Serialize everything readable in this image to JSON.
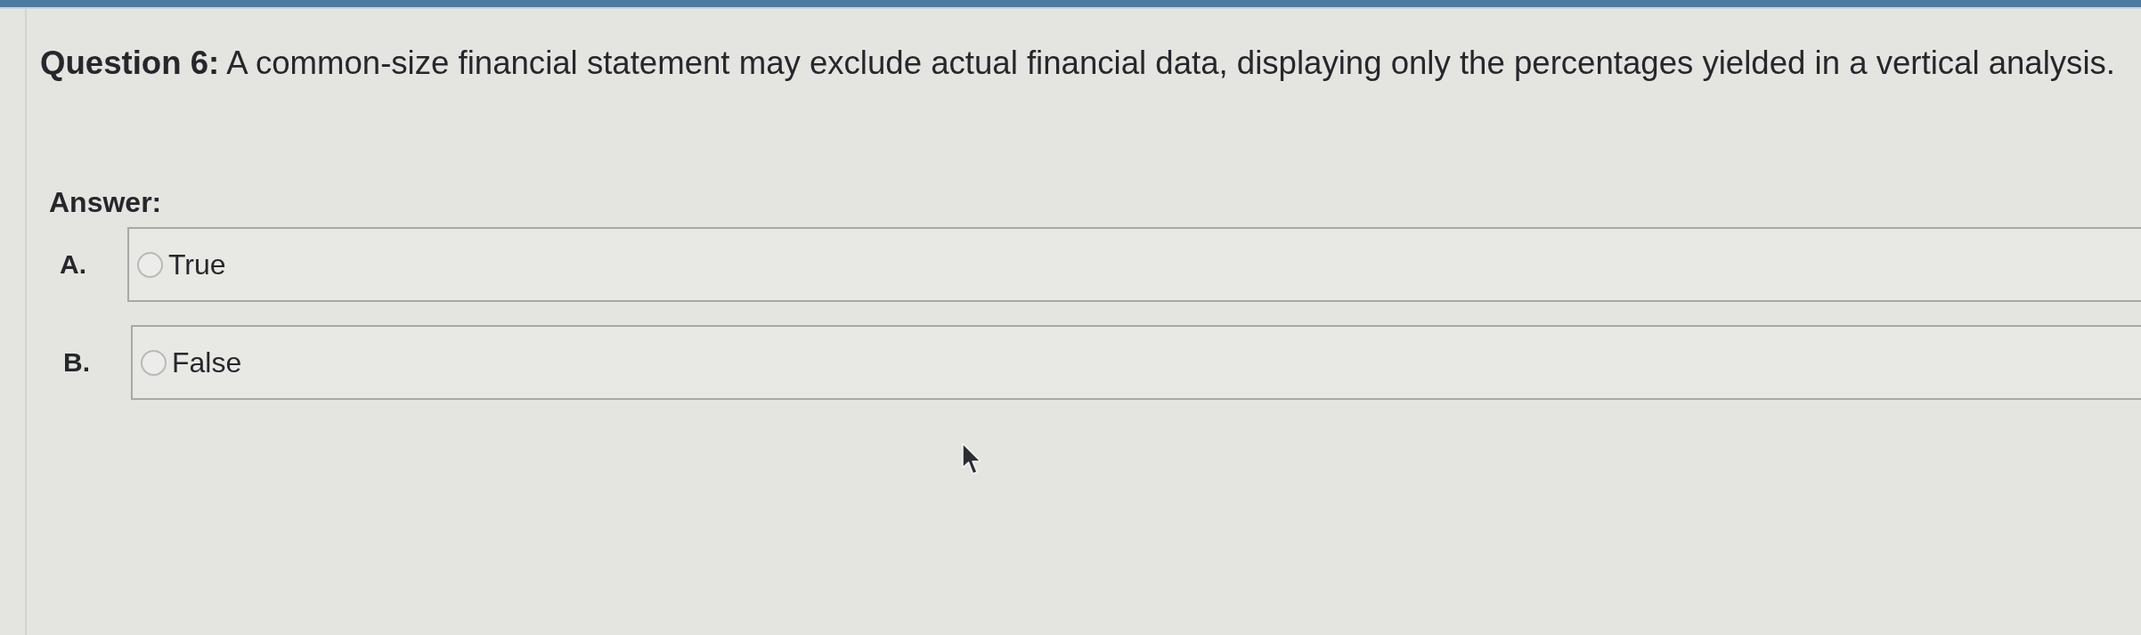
{
  "question": {
    "text": "**Question 6:** A common-size financial statement may exclude actual financial data, displaying only the percentages yielded in a vertical analysis."
  },
  "answer_label": "Answer:",
  "options": [
    {
      "letter": "A.",
      "label": "True",
      "selected": false
    },
    {
      "letter": "B.",
      "label": "False",
      "selected": false
    }
  ]
}
